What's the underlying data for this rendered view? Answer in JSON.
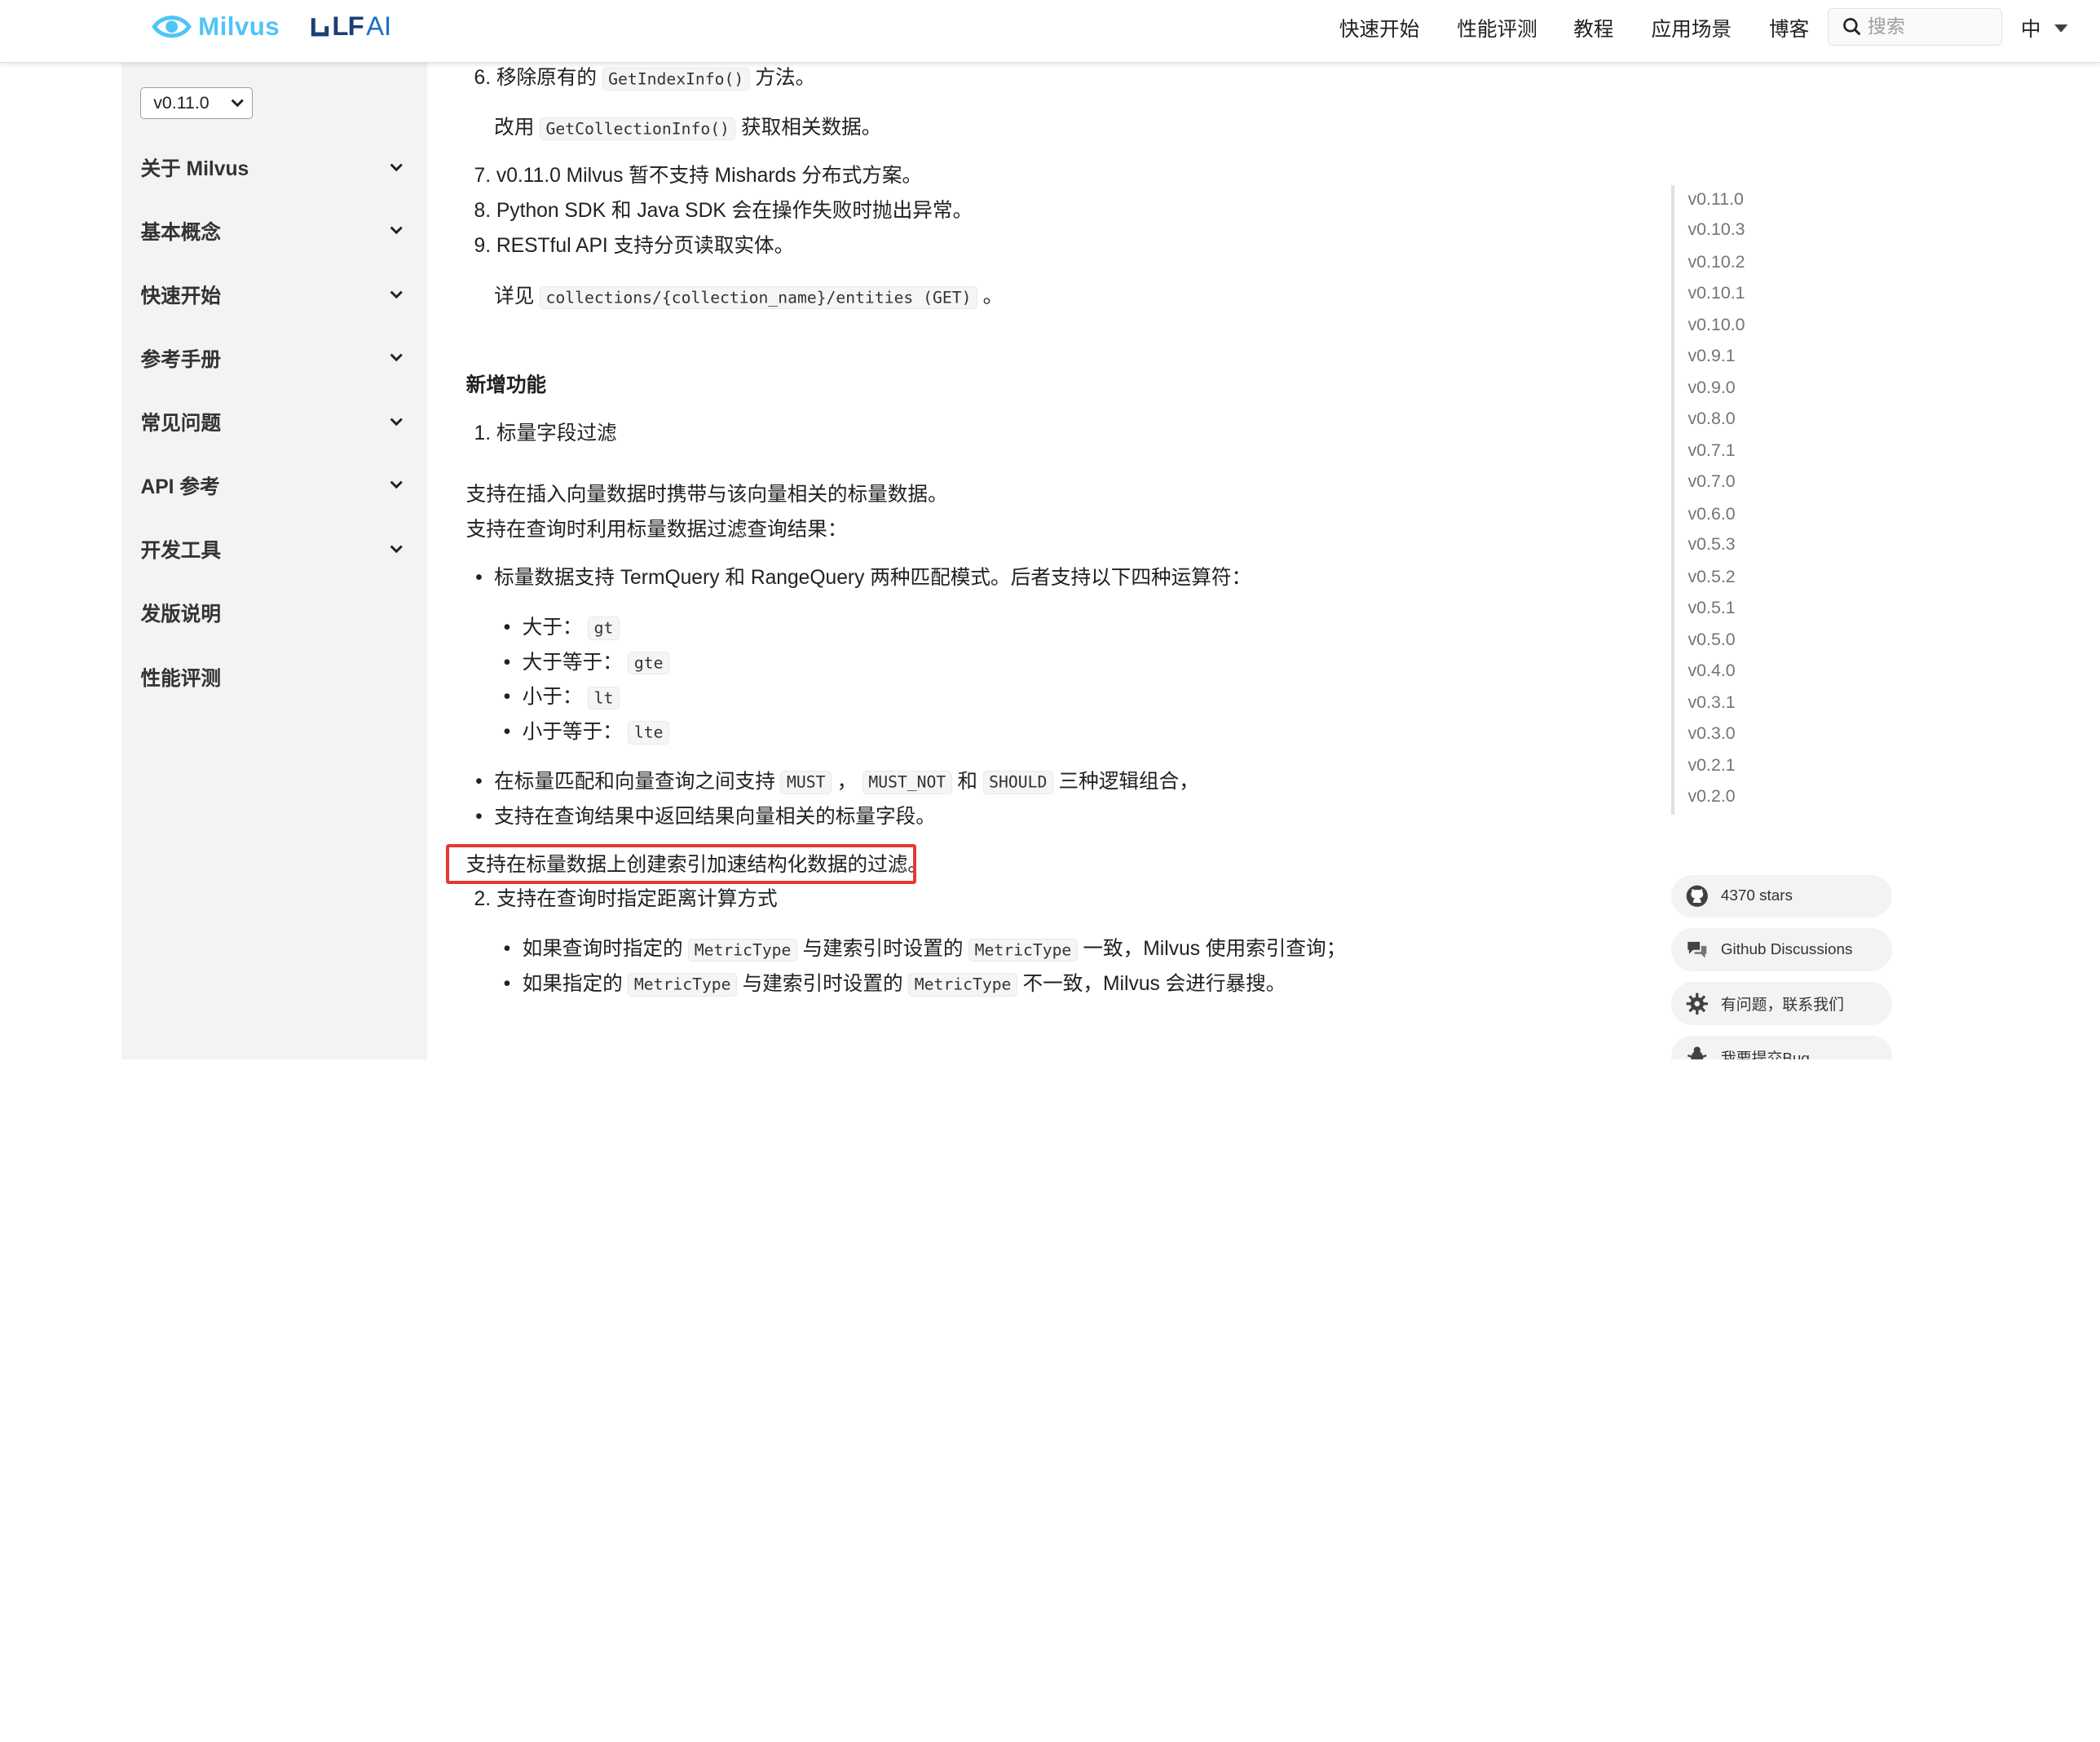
{
  "header": {
    "logo_text": "Milvus",
    "partner_logo_lf": "LF",
    "partner_logo_ai": "AI",
    "nav": [
      "快速开始",
      "性能评测",
      "教程",
      "应用场景",
      "博客"
    ],
    "search_placeholder": "搜索",
    "language": "中"
  },
  "sidebar": {
    "version": "v0.11.0",
    "items": [
      {
        "label": "关于 Milvus",
        "expandable": true
      },
      {
        "label": "基本概念",
        "expandable": true
      },
      {
        "label": "快速开始",
        "expandable": true
      },
      {
        "label": "参考手册",
        "expandable": true
      },
      {
        "label": "常见问题",
        "expandable": true
      },
      {
        "label": "API 参考",
        "expandable": true
      },
      {
        "label": "开发工具",
        "expandable": true
      },
      {
        "label": "发版说明",
        "expandable": false
      },
      {
        "label": "性能评测",
        "expandable": false
      }
    ]
  },
  "content": {
    "item6_num": "6.",
    "item6_pre": "移除原有的",
    "item6_code": "GetIndexInfo()",
    "item6_post": "方法。",
    "item6_sub_pre": "改用",
    "item6_sub_code": "GetCollectionInfo()",
    "item6_sub_post": "获取相关数据。",
    "item7": "7. v0.11.0 Milvus 暂不支持 Mishards 分布式方案。",
    "item8": "8. Python SDK 和 Java SDK 会在操作失败时抛出异常。",
    "item9": "9. RESTful API 支持分页读取实体。",
    "item9_sub_pre": "详见",
    "item9_sub_code": "collections/{collection_name}/entities (GET)",
    "item9_sub_post": "。",
    "section_title": "新增功能",
    "feature1": "1. 标量字段过滤",
    "para1": "支持在插入向量数据时携带与该向量相关的标量数据。",
    "para2": "支持在查询时利用标量数据过滤查询结果：",
    "bullet1": "标量数据支持 TermQuery 和 RangeQuery 两种匹配模式。后者支持以下四种运算符：",
    "ops": [
      {
        "label": "大于：",
        "code": "gt"
      },
      {
        "label": "大于等于：",
        "code": "gte"
      },
      {
        "label": "小于：",
        "code": "lt"
      },
      {
        "label": "小于等于：",
        "code": "lte"
      }
    ],
    "bullet2_pre": "在标量匹配和向量查询之间支持",
    "bullet2_code1": "MUST",
    "bullet2_sep": "，",
    "bullet2_code2": "MUST_NOT",
    "bullet2_and": "和",
    "bullet2_code3": "SHOULD",
    "bullet2_post": "三种逻辑组合，",
    "bullet3": "支持在查询结果中返回结果向量相关的标量字段。",
    "highlighted": "支持在标量数据上创建索引加速结构化数据的过滤。",
    "feature2": "2. 支持在查询时指定距离计算方式",
    "metric1_pre": "如果查询时指定的",
    "metric1_code1": "MetricType",
    "metric1_mid": "与建索引时设置的",
    "metric1_code2": "MetricType",
    "metric1_post": "一致，Milvus 使用索引查询；",
    "metric2_pre": "如果指定的",
    "metric2_code1": "MetricType",
    "metric2_mid": "与建索引时设置的",
    "metric2_code2": "MetricType",
    "metric2_post": "不一致，Milvus 会进行暴搜。"
  },
  "versions": [
    "v0.11.0",
    "v0.10.3",
    "v0.10.2",
    "v0.10.1",
    "v0.10.0",
    "v0.9.1",
    "v0.9.0",
    "v0.8.0",
    "v0.7.1",
    "v0.7.0",
    "v0.6.0",
    "v0.5.3",
    "v0.5.2",
    "v0.5.1",
    "v0.5.0",
    "v0.4.0",
    "v0.3.1",
    "v0.3.0",
    "v0.2.1",
    "v0.2.0"
  ],
  "actions": [
    {
      "label": "4370 stars",
      "icon": "github-icon"
    },
    {
      "label": "Github Discussions",
      "icon": "chat-icon"
    },
    {
      "label": "有问题，联系我们",
      "icon": "gear-icon"
    },
    {
      "label": "我要提交Bug",
      "icon": "bug-icon"
    }
  ],
  "colors": {
    "accent": "#4fc4f9",
    "highlight_border": "#e53935",
    "sidebar_bg": "#f3f3f3"
  }
}
